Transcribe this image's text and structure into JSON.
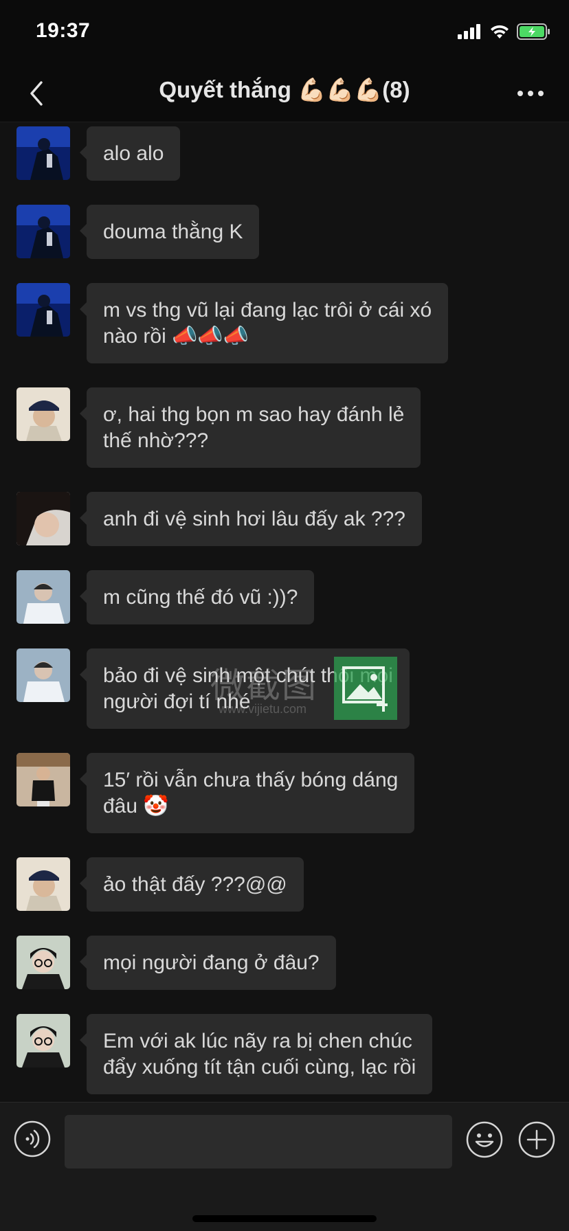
{
  "status_bar": {
    "time": "19:37"
  },
  "header": {
    "title": "Quyết thắng 💪🏻💪🏻💪🏻(8)"
  },
  "messages": [
    {
      "text": "alo alo"
    },
    {
      "text": "douma thằng K"
    },
    {
      "line1": "m vs thg vũ lại đang lạc trôi ở cái xó",
      "line2": "nào rồi 📣📣📣"
    },
    {
      "line1": "ơ, hai thg bọn m sao hay đánh lẻ",
      "line2": "thế nhờ???"
    },
    {
      "text": "anh đi vệ sinh hơi lâu đấy ak ???"
    },
    {
      "text": "m cũng thế đó vũ :))?"
    },
    {
      "line1": "bảo đi vệ sinh một chút thôi mọi",
      "line2": "người đợi tí nhé"
    },
    {
      "line1": "15′ rồi vẫn chưa thấy bóng dáng",
      "line2": "đâu 🤡"
    },
    {
      "text": "ảo thật đấy ???@@"
    },
    {
      "text": "mọi người đang ở đâu?"
    },
    {
      "line1": "Em với ak lúc nãy ra bị chen chúc",
      "line2": "đẩy xuống tít tận cuối cùng, lạc rồi"
    }
  ],
  "watermark": {
    "text": "微截图",
    "url": "www.vijietu.com"
  },
  "input": {
    "value": "",
    "placeholder": ""
  },
  "colors": {
    "background": "#121212",
    "bubble": "#2b2b2b",
    "battery": "#4cd964",
    "watermark_logo": "#2ea050"
  }
}
